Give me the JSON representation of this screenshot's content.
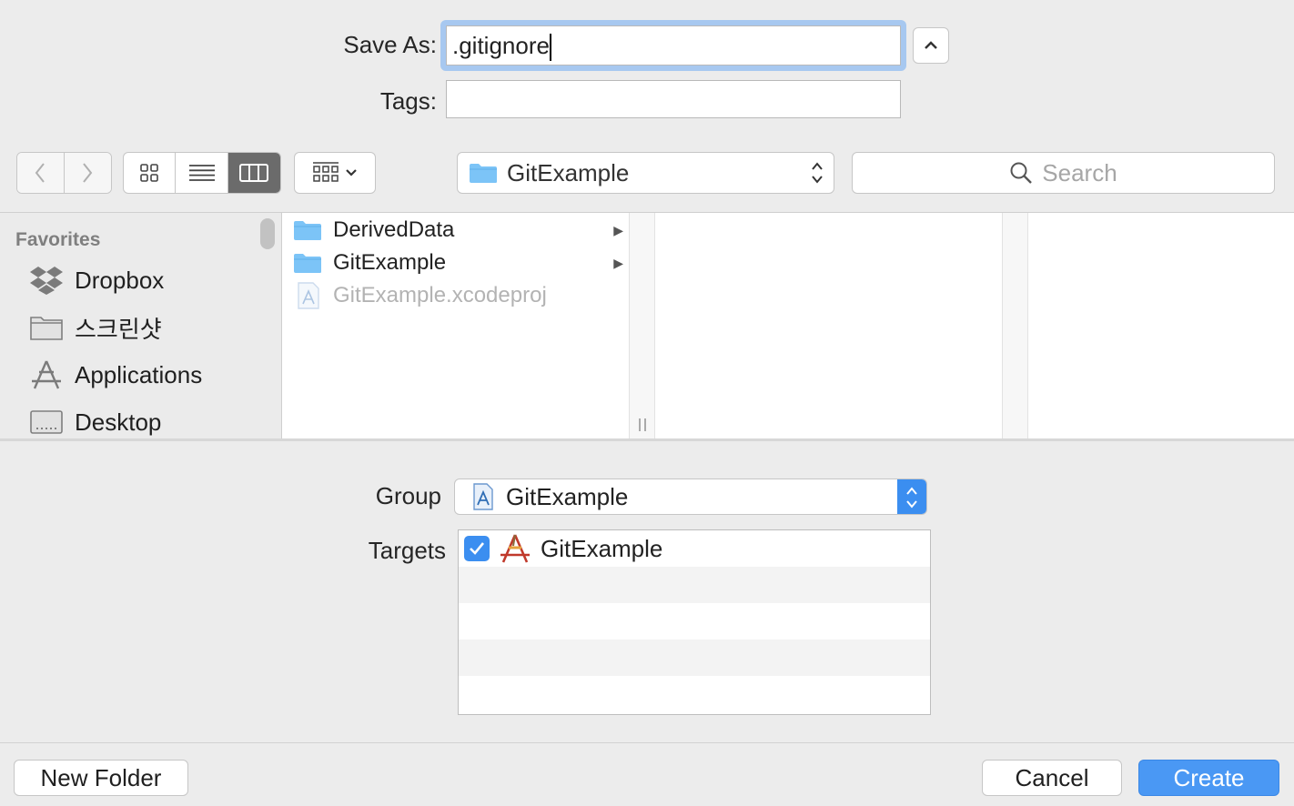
{
  "save": {
    "label": "Save As:",
    "value": ".gitignore"
  },
  "tags": {
    "label": "Tags:",
    "value": ""
  },
  "toolbar": {
    "location": "GitExample",
    "search_placeholder": "Search"
  },
  "sidebar": {
    "title": "Favorites",
    "items": [
      {
        "label": "Dropbox",
        "icon": "dropbox-icon"
      },
      {
        "label": "스크린샷",
        "icon": "folder-icon"
      },
      {
        "label": "Applications",
        "icon": "applications-icon"
      },
      {
        "label": "Desktop",
        "icon": "desktop-icon"
      }
    ]
  },
  "browser": {
    "column1": [
      {
        "name": "DerivedData",
        "type": "folder",
        "has_children": true
      },
      {
        "name": "GitExample",
        "type": "folder",
        "has_children": true
      },
      {
        "name": "GitExample.xcodeproj",
        "type": "xcodeproj",
        "disabled": true
      }
    ]
  },
  "options": {
    "group_label": "Group",
    "group_value": "GitExample",
    "targets_label": "Targets",
    "targets": [
      {
        "name": "GitExample",
        "checked": true
      }
    ]
  },
  "buttons": {
    "new_folder": "New Folder",
    "cancel": "Cancel",
    "create": "Create"
  },
  "colors": {
    "accent": "#3b8ef0",
    "folder": "#7cc4f7",
    "focus_ring": "#a7c8f0"
  }
}
